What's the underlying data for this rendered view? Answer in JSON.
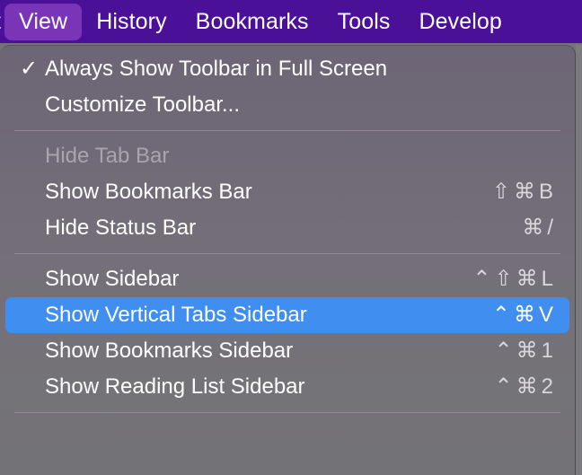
{
  "menubar": {
    "background_color": "#4a1098",
    "active_background_color": "#7a34b8",
    "items": [
      {
        "label": "t",
        "active": false,
        "truncated": true
      },
      {
        "label": "View",
        "active": true,
        "truncated": false
      },
      {
        "label": "History",
        "active": false,
        "truncated": false
      },
      {
        "label": "Bookmarks",
        "active": false,
        "truncated": false
      },
      {
        "label": "Tools",
        "active": false,
        "truncated": false
      },
      {
        "label": "Develop",
        "active": false,
        "truncated": false
      }
    ]
  },
  "menu": {
    "title": "View",
    "highlight_color": "#3f8ef0",
    "groups": [
      {
        "items": [
          {
            "label": "Always Show Toolbar in Full Screen",
            "checked": true,
            "shortcut": "",
            "disabled": false,
            "highlighted": false
          },
          {
            "label": "Customize Toolbar...",
            "checked": false,
            "shortcut": "",
            "disabled": false,
            "highlighted": false
          }
        ]
      },
      {
        "items": [
          {
            "label": "Hide Tab Bar",
            "checked": false,
            "shortcut": "",
            "disabled": true,
            "highlighted": false
          },
          {
            "label": "Show Bookmarks Bar",
            "checked": false,
            "shortcut": "⇧⌘B",
            "disabled": false,
            "highlighted": false
          },
          {
            "label": "Hide Status Bar",
            "checked": false,
            "shortcut": "⌘/",
            "disabled": false,
            "highlighted": false
          }
        ]
      },
      {
        "items": [
          {
            "label": "Show Sidebar",
            "checked": false,
            "shortcut": "⌃⇧⌘L",
            "disabled": false,
            "highlighted": false
          },
          {
            "label": "Show Vertical Tabs Sidebar",
            "checked": false,
            "shortcut": "⌃⌘V",
            "disabled": false,
            "highlighted": true
          },
          {
            "label": "Show Bookmarks Sidebar",
            "checked": false,
            "shortcut": "⌃⌘1",
            "disabled": false,
            "highlighted": false
          },
          {
            "label": "Show Reading List Sidebar",
            "checked": false,
            "shortcut": "⌃⌘2",
            "disabled": false,
            "highlighted": false
          }
        ]
      },
      {
        "items": []
      }
    ],
    "check_glyph": "✓"
  }
}
